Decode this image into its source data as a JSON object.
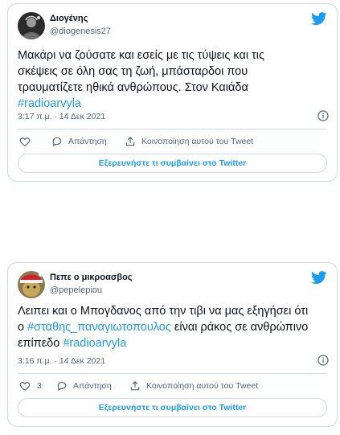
{
  "colors": {
    "accent": "#1d9bf0",
    "text": "#0f1419",
    "muted": "#536471",
    "border": "#cfd9de"
  },
  "tweets": [
    {
      "name": "Διογένης",
      "handle": "@diogenesis27",
      "avatar_icon": "diogenes-avatar",
      "text_lines": [
        "Μακάρι να ζούσατε και εσείς με τις τύψεις και τις",
        "σκέψεις σε όλη σας τη ζωή, μπάσταρδοι που",
        "τραυματίζετε ηθικά ανθρώπους. Στον Καιάδα"
      ],
      "hashtag": "#radioarvyla",
      "timestamp": "3:17 π.μ. · 14 Δεκ 2021",
      "like_count": "",
      "reply_label": "Απάντηση",
      "share_label": "Κοινοποίηση αυτού του Tweet",
      "explore_label": "Εξερευνήστε τι συμβαίνει στο Twitter"
    },
    {
      "name": "Πεπε ο μικροασβος",
      "handle": "@pepelepiou",
      "avatar_icon": "pepe-santa-hat-avatar",
      "line1": "Λειπει και ο Μπογδανος από την τιβι να μας εξηγήσει ότι",
      "line2_prefix": "ο ",
      "line2_hashtag": "#σταθης_παναγιωτοπουλος",
      "line2_suffix": " είναι ράκος σε ανθρώπινο",
      "line3_text": "επίπεδο ",
      "hashtag": "#radioarvyla",
      "timestamp": "3:16 π.μ. · 14 Δεκ 2021",
      "like_count": "3",
      "reply_label": "Απάντηση",
      "share_label": "Κοινοποίηση αυτού του Tweet",
      "explore_label": "Εξερευνήστε τι συμβαίνει στο Twitter"
    }
  ]
}
